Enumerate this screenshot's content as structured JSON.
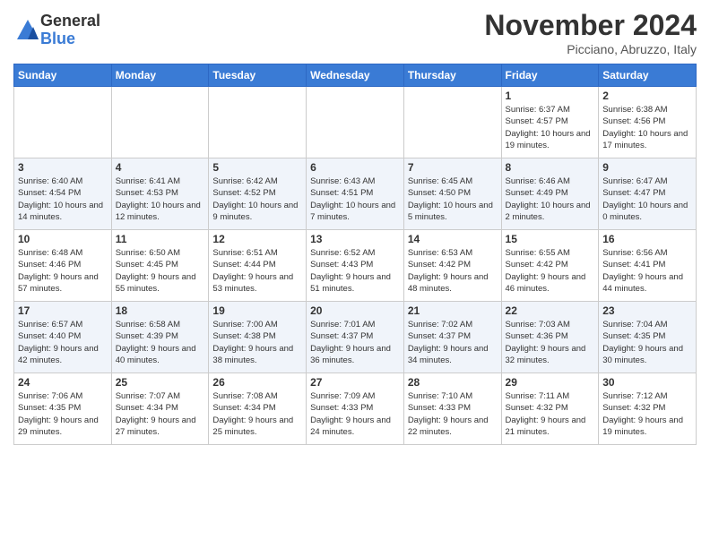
{
  "logo": {
    "general": "General",
    "blue": "Blue"
  },
  "title": "November 2024",
  "location": "Picciano, Abruzzo, Italy",
  "days_header": [
    "Sunday",
    "Monday",
    "Tuesday",
    "Wednesday",
    "Thursday",
    "Friday",
    "Saturday"
  ],
  "weeks": [
    [
      {
        "day": "",
        "info": ""
      },
      {
        "day": "",
        "info": ""
      },
      {
        "day": "",
        "info": ""
      },
      {
        "day": "",
        "info": ""
      },
      {
        "day": "",
        "info": ""
      },
      {
        "day": "1",
        "info": "Sunrise: 6:37 AM\nSunset: 4:57 PM\nDaylight: 10 hours and 19 minutes."
      },
      {
        "day": "2",
        "info": "Sunrise: 6:38 AM\nSunset: 4:56 PM\nDaylight: 10 hours and 17 minutes."
      }
    ],
    [
      {
        "day": "3",
        "info": "Sunrise: 6:40 AM\nSunset: 4:54 PM\nDaylight: 10 hours and 14 minutes."
      },
      {
        "day": "4",
        "info": "Sunrise: 6:41 AM\nSunset: 4:53 PM\nDaylight: 10 hours and 12 minutes."
      },
      {
        "day": "5",
        "info": "Sunrise: 6:42 AM\nSunset: 4:52 PM\nDaylight: 10 hours and 9 minutes."
      },
      {
        "day": "6",
        "info": "Sunrise: 6:43 AM\nSunset: 4:51 PM\nDaylight: 10 hours and 7 minutes."
      },
      {
        "day": "7",
        "info": "Sunrise: 6:45 AM\nSunset: 4:50 PM\nDaylight: 10 hours and 5 minutes."
      },
      {
        "day": "8",
        "info": "Sunrise: 6:46 AM\nSunset: 4:49 PM\nDaylight: 10 hours and 2 minutes."
      },
      {
        "day": "9",
        "info": "Sunrise: 6:47 AM\nSunset: 4:47 PM\nDaylight: 10 hours and 0 minutes."
      }
    ],
    [
      {
        "day": "10",
        "info": "Sunrise: 6:48 AM\nSunset: 4:46 PM\nDaylight: 9 hours and 57 minutes."
      },
      {
        "day": "11",
        "info": "Sunrise: 6:50 AM\nSunset: 4:45 PM\nDaylight: 9 hours and 55 minutes."
      },
      {
        "day": "12",
        "info": "Sunrise: 6:51 AM\nSunset: 4:44 PM\nDaylight: 9 hours and 53 minutes."
      },
      {
        "day": "13",
        "info": "Sunrise: 6:52 AM\nSunset: 4:43 PM\nDaylight: 9 hours and 51 minutes."
      },
      {
        "day": "14",
        "info": "Sunrise: 6:53 AM\nSunset: 4:42 PM\nDaylight: 9 hours and 48 minutes."
      },
      {
        "day": "15",
        "info": "Sunrise: 6:55 AM\nSunset: 4:42 PM\nDaylight: 9 hours and 46 minutes."
      },
      {
        "day": "16",
        "info": "Sunrise: 6:56 AM\nSunset: 4:41 PM\nDaylight: 9 hours and 44 minutes."
      }
    ],
    [
      {
        "day": "17",
        "info": "Sunrise: 6:57 AM\nSunset: 4:40 PM\nDaylight: 9 hours and 42 minutes."
      },
      {
        "day": "18",
        "info": "Sunrise: 6:58 AM\nSunset: 4:39 PM\nDaylight: 9 hours and 40 minutes."
      },
      {
        "day": "19",
        "info": "Sunrise: 7:00 AM\nSunset: 4:38 PM\nDaylight: 9 hours and 38 minutes."
      },
      {
        "day": "20",
        "info": "Sunrise: 7:01 AM\nSunset: 4:37 PM\nDaylight: 9 hours and 36 minutes."
      },
      {
        "day": "21",
        "info": "Sunrise: 7:02 AM\nSunset: 4:37 PM\nDaylight: 9 hours and 34 minutes."
      },
      {
        "day": "22",
        "info": "Sunrise: 7:03 AM\nSunset: 4:36 PM\nDaylight: 9 hours and 32 minutes."
      },
      {
        "day": "23",
        "info": "Sunrise: 7:04 AM\nSunset: 4:35 PM\nDaylight: 9 hours and 30 minutes."
      }
    ],
    [
      {
        "day": "24",
        "info": "Sunrise: 7:06 AM\nSunset: 4:35 PM\nDaylight: 9 hours and 29 minutes."
      },
      {
        "day": "25",
        "info": "Sunrise: 7:07 AM\nSunset: 4:34 PM\nDaylight: 9 hours and 27 minutes."
      },
      {
        "day": "26",
        "info": "Sunrise: 7:08 AM\nSunset: 4:34 PM\nDaylight: 9 hours and 25 minutes."
      },
      {
        "day": "27",
        "info": "Sunrise: 7:09 AM\nSunset: 4:33 PM\nDaylight: 9 hours and 24 minutes."
      },
      {
        "day": "28",
        "info": "Sunrise: 7:10 AM\nSunset: 4:33 PM\nDaylight: 9 hours and 22 minutes."
      },
      {
        "day": "29",
        "info": "Sunrise: 7:11 AM\nSunset: 4:32 PM\nDaylight: 9 hours and 21 minutes."
      },
      {
        "day": "30",
        "info": "Sunrise: 7:12 AM\nSunset: 4:32 PM\nDaylight: 9 hours and 19 minutes."
      }
    ]
  ]
}
